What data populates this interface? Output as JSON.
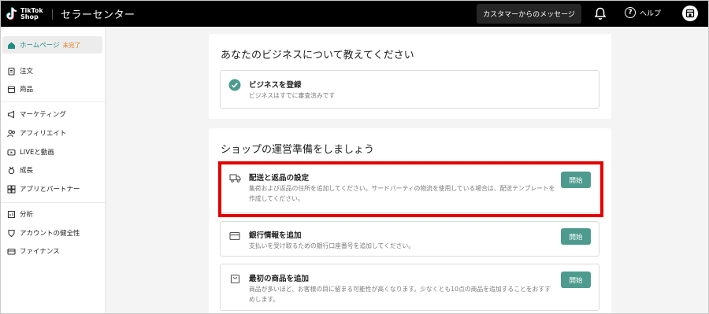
{
  "header": {
    "logo_line1": "TikTok",
    "logo_line2": "Shop",
    "app_title": "セラーセンター",
    "message_button": "カスタマーからのメッセージ",
    "help_label": "ヘルプ",
    "icons": [
      "tiktok-logo-icon",
      "bell-icon",
      "help-icon",
      "store-icon"
    ]
  },
  "sidebar": {
    "items": [
      {
        "label": "ホームページ",
        "badge": "未完了",
        "icon": "home-icon",
        "active": true
      },
      {
        "label": "注文",
        "icon": "clipboard-icon"
      },
      {
        "label": "商品",
        "icon": "box-icon"
      },
      {
        "label": "マーケティング",
        "icon": "megaphone-icon"
      },
      {
        "label": "アフィリエイト",
        "icon": "people-icon"
      },
      {
        "label": "LIVEと動画",
        "icon": "live-icon"
      },
      {
        "label": "成長",
        "icon": "trophy-icon"
      },
      {
        "label": "アプリとパートナー",
        "icon": "apps-icon"
      },
      {
        "label": "分析",
        "icon": "chart-icon"
      },
      {
        "label": "アカウントの健全性",
        "icon": "shield-icon"
      },
      {
        "label": "ファイナンス",
        "icon": "wallet-icon"
      }
    ]
  },
  "business_card": {
    "title": "あなたのビジネスについて教えてください",
    "task": {
      "title": "ビジネスを登録",
      "desc": "ビジネスはすでに審査済みです"
    }
  },
  "shop_card": {
    "title": "ショップの運営準備をしましょう",
    "tasks": [
      {
        "title": "配送と返品の設定",
        "desc": "集荷および返品の住所を追加してください。サードパーティの物流を使用している場合は、配送テンプレートを作成してください。",
        "button": "開始",
        "icon": "truck-icon"
      },
      {
        "title": "銀行情報を追加",
        "desc": "支払いを受け取るための銀行口座番号を追加してください。",
        "button": "開始",
        "icon": "card-icon"
      },
      {
        "title": "最初の商品を追加",
        "desc": "商品が多いほど、お客様の目に留まる可能性が高くなります。少なくとも10点の商品を追加することをおすすめします。",
        "button": "開始",
        "icon": "bag-icon"
      }
    ]
  },
  "colors": {
    "accent": "#4d9b8f",
    "highlight": "#e30000",
    "badge": "#e07a1a"
  }
}
